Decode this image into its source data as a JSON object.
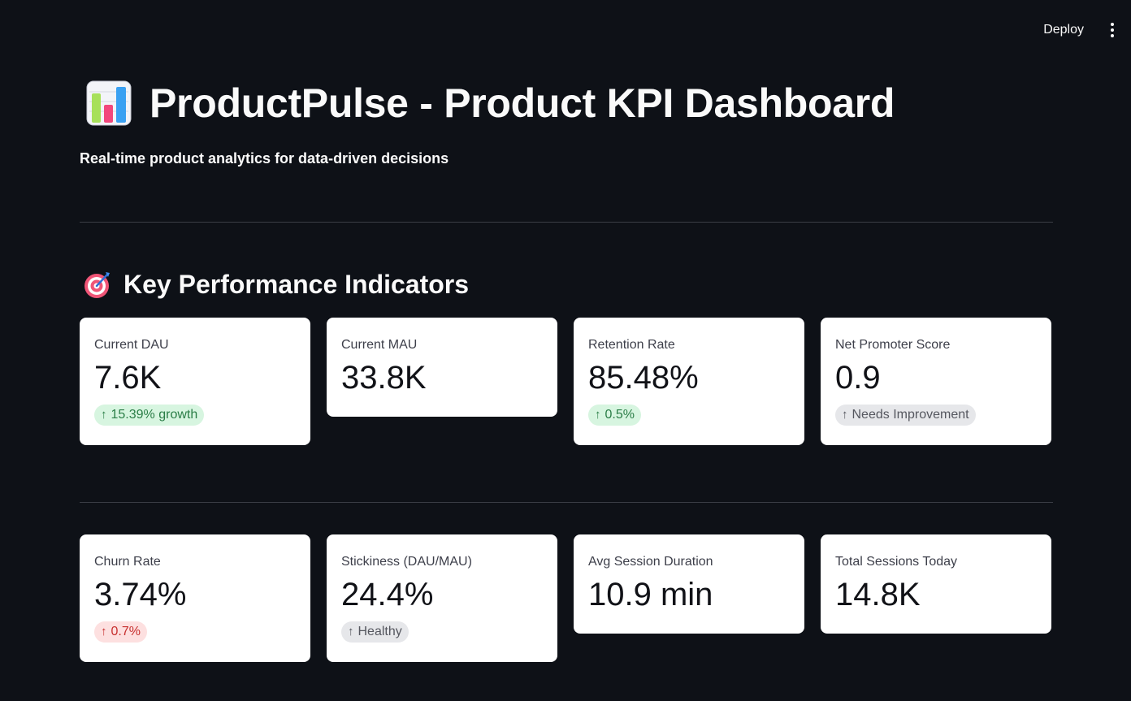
{
  "toolbar": {
    "deploy_label": "Deploy",
    "menu_icon": "vertical-dots-icon"
  },
  "header": {
    "icon": "bar-chart-icon",
    "title": "ProductPulse - Product KPI Dashboard",
    "subtitle": "Real-time product analytics for data-driven decisions"
  },
  "kpi_section": {
    "icon": "target-icon",
    "title": "Key Performance Indicators"
  },
  "rows": [
    [
      {
        "label": "Current DAU",
        "value": "7.6K",
        "delta": "15.39% growth",
        "delta_color": "green",
        "delta_icon": "arrow-up-icon"
      },
      {
        "label": "Current MAU",
        "value": "33.8K",
        "delta": null
      },
      {
        "label": "Retention Rate",
        "value": "85.48%",
        "delta": "0.5%",
        "delta_color": "green",
        "delta_icon": "arrow-up-icon"
      },
      {
        "label": "Net Promoter Score",
        "value": "0.9",
        "delta": "Needs Improvement",
        "delta_color": "gray",
        "delta_icon": "arrow-up-icon"
      }
    ],
    [
      {
        "label": "Churn Rate",
        "value": "3.74%",
        "delta": "0.7%",
        "delta_color": "red",
        "delta_icon": "arrow-up-icon"
      },
      {
        "label": "Stickiness (DAU/MAU)",
        "value": "24.4%",
        "delta": "Healthy",
        "delta_color": "gray",
        "delta_icon": "arrow-up-icon"
      },
      {
        "label": "Avg Session Duration",
        "value": "10.9 min",
        "delta": null
      },
      {
        "label": "Total Sessions Today",
        "value": "14.8K",
        "delta": null
      }
    ]
  ],
  "colors": {
    "background": "#0e1117",
    "card": "#ffffff",
    "delta_green_bg": "#d7f5e0",
    "delta_green_fg": "#2a7d46",
    "delta_red_bg": "#fde0e0",
    "delta_red_fg": "#c7302f",
    "delta_gray_bg": "#e6e7ea",
    "delta_gray_fg": "#55575f"
  }
}
